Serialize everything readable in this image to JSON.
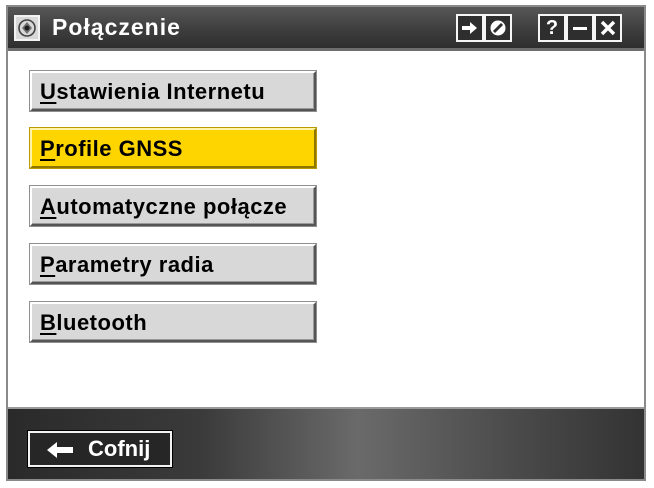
{
  "window": {
    "title": "Połączenie",
    "title_icon": "connection-app-icon",
    "title_buttons": [
      {
        "name": "forward-arrow-icon",
        "label": ""
      },
      {
        "name": "ok-circle-icon",
        "label": ""
      },
      {
        "name": "help-icon",
        "label": "?"
      },
      {
        "name": "minimize-icon",
        "label": "–"
      },
      {
        "name": "close-icon",
        "label": "X"
      }
    ]
  },
  "menu": {
    "items": [
      {
        "mnemonic": "U",
        "rest": "stawienia Internetu",
        "state": "normal"
      },
      {
        "mnemonic": "P",
        "rest": "rofile GNSS",
        "state": "selected"
      },
      {
        "mnemonic": "A",
        "rest": "utomatyczne połącze",
        "state": "normal"
      },
      {
        "mnemonic": "P",
        "rest": "arametry radia",
        "state": "normal"
      },
      {
        "mnemonic": "B",
        "rest": "luetooth",
        "state": "normal"
      }
    ]
  },
  "bottom": {
    "back_label": "Cofnij",
    "back_icon": "left-arrow-icon"
  },
  "colors": {
    "titlebar": "#3e3e3e",
    "selected": "#ffd500",
    "button_face": "#d8d8d8",
    "bottombar": "#4a4a4a"
  }
}
